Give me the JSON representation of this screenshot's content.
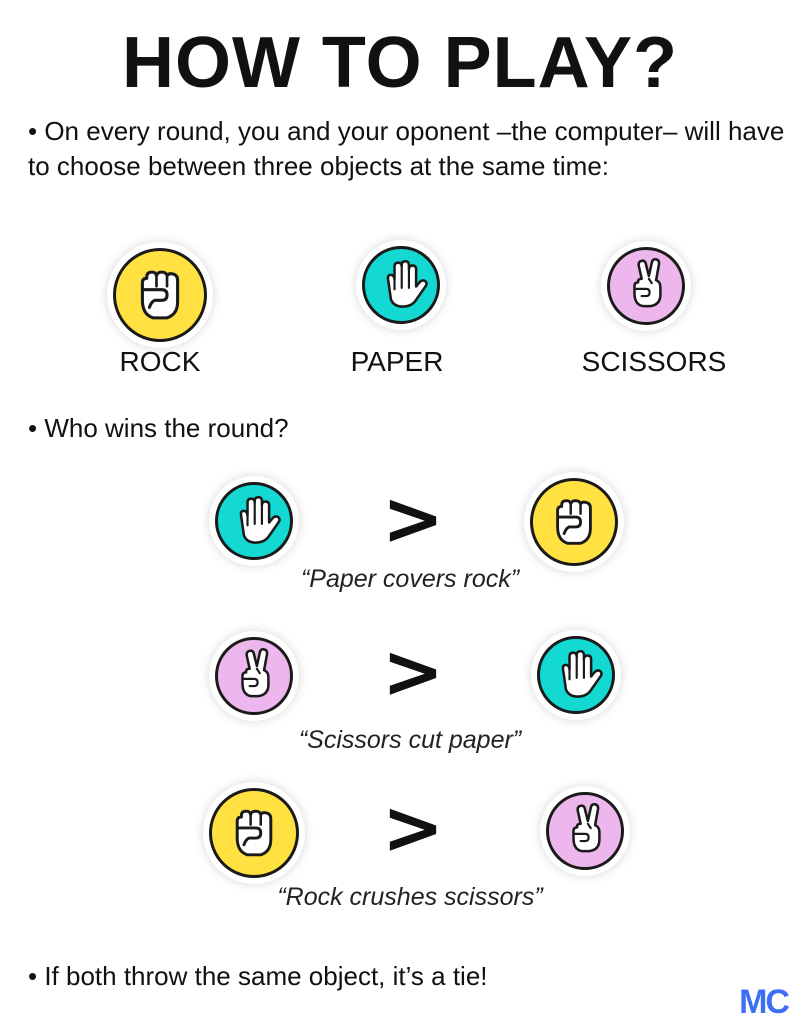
{
  "title": "HOW TO PLAY?",
  "bullets": {
    "intro": "• On every round, you and your oponent –the computer– will have to choose between three objects at the same time:",
    "who_wins": "• Who wins the round?",
    "tie": "• If both throw the same object, it’s a tie!"
  },
  "objects": [
    {
      "label": "ROCK",
      "icon": "rock-fist-icon",
      "color": "#FFE141"
    },
    {
      "label": "PAPER",
      "icon": "paper-hand-icon",
      "color": "#14D8D2"
    },
    {
      "label": "SCISSORS",
      "icon": "scissors-hand-icon",
      "color": "#EDB6EC"
    }
  ],
  "rules": [
    {
      "winner": "paper",
      "loser": "rock",
      "symbol": ">",
      "caption": "“Paper covers rock”"
    },
    {
      "winner": "scissors",
      "loser": "paper",
      "symbol": ">",
      "caption": "“Scissors cut paper”"
    },
    {
      "winner": "rock",
      "loser": "scissors",
      "symbol": ">",
      "caption": "“Rock crushes scissors”"
    }
  ],
  "logo": {
    "text": "MC",
    "color": "#3D6FF2"
  },
  "colors": {
    "rock": "#FFE141",
    "paper": "#14D8D2",
    "scissors": "#EDB6EC",
    "outline": "#1a1a1a"
  }
}
